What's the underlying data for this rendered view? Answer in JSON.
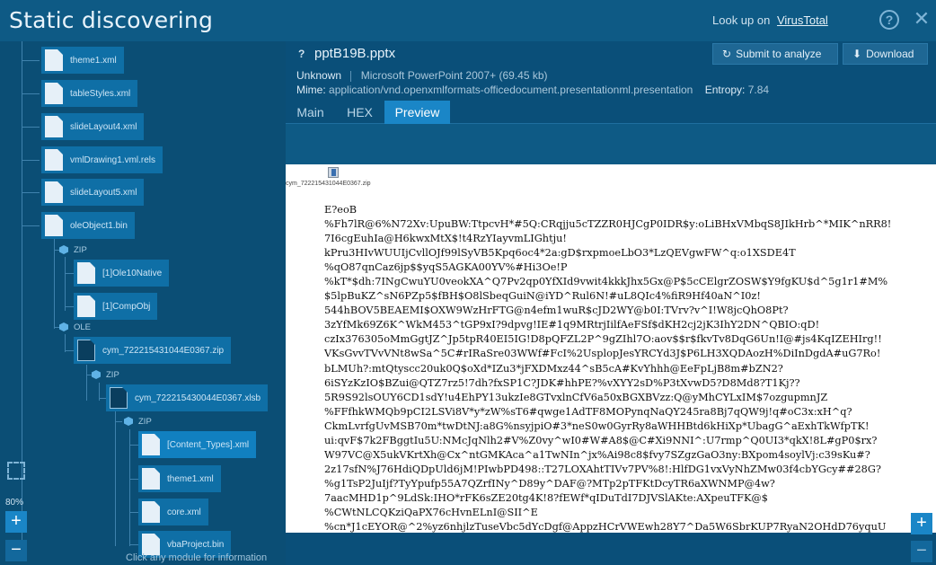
{
  "app": {
    "title": "Static discovering",
    "lookup_text": "Look up on",
    "lookup_link": "VirusTotal",
    "help_icon": "?",
    "close_icon": "✕"
  },
  "tree": {
    "nodes": [
      {
        "label": "theme1.xml"
      },
      {
        "label": "tableStyles.xml"
      },
      {
        "label": "slideLayout4.xml"
      },
      {
        "label": "vmlDrawing1.vml.rels"
      },
      {
        "label": "slideLayout5.xml"
      },
      {
        "label": "oleObject1.bin"
      },
      {
        "label": "[1]Ole10Native"
      },
      {
        "label": "[1]CompObj"
      },
      {
        "label": "cym_722215431044E0367.zip"
      },
      {
        "label": "cym_722215430044E0367.xlsb"
      },
      {
        "label": "[Content_Types].xml"
      },
      {
        "label": "theme1.xml"
      },
      {
        "label": "core.xml"
      },
      {
        "label": "vbaProject.bin"
      }
    ],
    "types": [
      "ZIP",
      "OLE",
      "ZIP",
      "ZIP"
    ],
    "zoom_level": "80%",
    "zoom_in": "+",
    "zoom_out": "−",
    "hint": "Click any module for information"
  },
  "file": {
    "question_mark": "?",
    "name": "pptB19B.pptx",
    "submit_label": "Submit to analyze",
    "download_label": "Download",
    "verdict": "Unknown",
    "format": "Microsoft PowerPoint 2007+ (69.45 kb)",
    "mime_label": "Mime:",
    "mime": "application/vnd.openxmlformats-officedocument.presentationml.presentation",
    "entropy_label": "Entropy:",
    "entropy": "7.84"
  },
  "tabs": [
    {
      "label": "Main"
    },
    {
      "label": "HEX"
    },
    {
      "label": "Preview",
      "active": true
    }
  ],
  "preview": {
    "embedded_name": "cym_722215431044E0367.zip",
    "lines": [
      "E?eoB",
      "%Fh7lR@6%N72Xv:UpuBW:TtpcvH*#5Q:CRqjju5cTZZR0HJCgP0IDR$y:oLiBHxVMbqS8JIkHrb^*MIK^nRR8!",
      "7I6cgEuhIa@H6kwxMtX$!t4RzYIayvmLIGhtju!",
      "kPru3HIvWUUIjCvllOJf99lSyVB5Kpq6oc4*2a:gD$rxpmoeLbO3*LzQEVgwFW^q:o1XSDE4T",
      "%qO87qnCaz6jp$$yqS5AGKA00YV%#Hi3Oe!P",
      "%kT*$dh:7INgCwuYU0veokXA^Q7Pv2qp0YfXId9vwit4kkkJhx5Gx@P$5cCElgrZOSW$Y9fgKU$d^5g1r1#M%",
      "$5lpBuKZ^sN6PZp5$fBH$O8lSbeqGuiN@iYD^Rul6N!#uL8QIc4%fiR9Hf40aN^I0z!",
      "544hBOV5BEAEMI$OXW9WzHrFTG@n4efm1wuR$cJD2WY@b0I:TVrv?v^I!W8jcQhO8Pt?",
      "3zYfMk69Z6K^WkM453^tGP9xI?9dpvg!IE#1q9MRtrjIilfAeFSf$dKH2cj2jK3IhY2DN^QBIO:qD!",
      "czIx376305oMmGgtJZ^Jp5tpR40EI5IG!D8pQFZL2P^9gZIhl7O:aov$$r$fkvTv8DqG6Un!I@#js4KqIZEHIrg!!",
      "VKsGvvTVvVNt8wSa^5C#rIRaSre03WWf#FcI%2UsplopJesYRCYd3J$P6LH3XQDAozH%DiInDgdA#uG7Ro!",
      "bLMUh?:mtQtyscc20uk0Q$oXd*IZu3*jFXDMxz44^sB5cA#KvYhhh@EeFpLjB8m#bZN2?",
      "6iSYzKzIO$BZui@QTZ7rz5!7dh?fxSP1C?JDK#hhPE?%vXYY2sD%P3tXvwD5?D8Md8?T1Kj??",
      "5R9S92lsOUY6CD1sdY!u4EhPY13ukzIe8GTvxlnCfV6a50xBGXBVzz:Q@yMhCYLxIM$7ozgupmnJZ",
      "%FFfhkWMQb9pCI2LSVi8V*y*zW%sT6#qwge1AdTF8MOPynqNaQY245ra8Bj7qQW9j!q#oC3x:xH^q?",
      "CkmLvrfgUvMSB70m*twDtNJ:a8G%nsyjpiO#3*neS0w0GyrRy8aWHHBtd6kHiXp*UbagG^aExhTkWfpTK!",
      "ui:qvF$7k2FBggtIu5U:NMcJqNlh2#V%Z0vy^wI0#W#A8$@C#Xi9NNI^:U7rmp^Q0UI3*qkX!8L#gP0$rx?",
      "W97VC@X5ukVKrtXh@Cx^ntGMKAca^a1TwNIn^jx%Ai98c8$fvy7SZgzGaO3ny:BXpom4soylVj:c39sKu#?",
      "2z17sfN%J76HdiQDpUld6jM!PIwbPD498::T27LOXAhtTIVv7PV%8!:HlfDG1vxVyNhZMw03f4cbYGcy##28G?",
      "%g1TsP2JuIjf?TyYpufp55A7QZrfINy^D89y^DAF@?MTp2pTFKtDcyTR6aXWNMP@4w?",
      "7aacMHD1p^9LdSk:IHO*rFK6sZE20tg4K!8?fEWf*qIDuTdI7DJVSlAKte:AXpeuTFK@$",
      "%CWtNLCQKziQaPX76cHvnELnI@SII^E",
      "%cn*J1cEYOR@^2%yz6nhjlzTuseVbc5dYcDgf@AppzHCrVWEwh28Y7^Da5W6SbrKUP7RyaN2OHdD76yquU"
    ]
  }
}
